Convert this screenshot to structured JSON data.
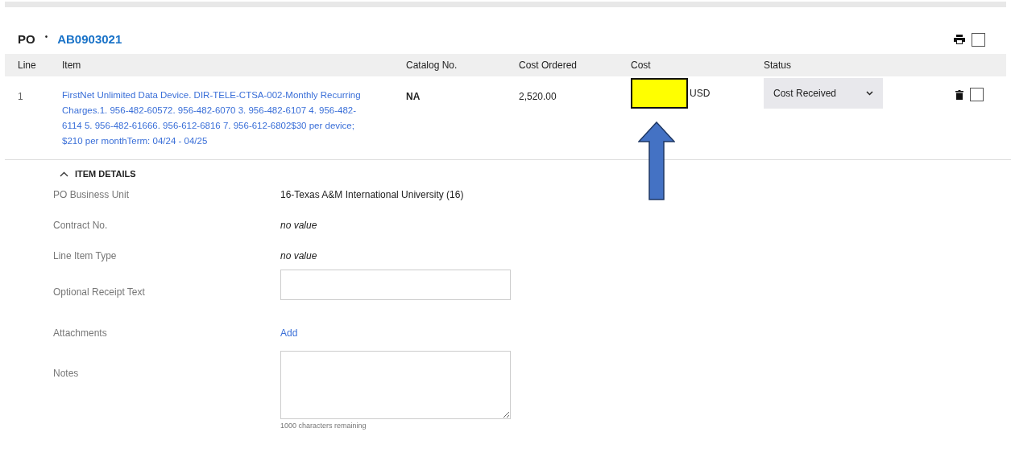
{
  "header": {
    "label": "PO",
    "separator": "•",
    "po_number": "AB0903021",
    "select_all_checked": false
  },
  "table": {
    "columns": [
      "Line",
      "Item",
      "Catalog No.",
      "Cost Ordered",
      "Cost",
      "Status"
    ],
    "rows": [
      {
        "line": "1",
        "item": "FirstNet Unlimited Data Device. DIR-TELE-CTSA-002-Monthly Recurring Charges.1. 956-482-60572. 956-482-6070 3. 956-482-6107 4. 956-482-6114 5. 956-482-61666. 956-612-6816 7. 956-612-6802$30 per device; $210 per monthTerm: 04/24 - 04/25",
        "catalog_no": "NA",
        "cost_ordered": "2,520.00",
        "cost": {
          "highlighted": true
        },
        "currency": "USD",
        "status": "Cost Received",
        "checked": false
      }
    ]
  },
  "item_details": {
    "title": "ITEM DETAILS",
    "expanded": true,
    "fields": [
      {
        "kind": "text",
        "label": "PO Business Unit",
        "value": "16-Texas A&M International University (16)"
      },
      {
        "kind": "empty",
        "label": "Contract No.",
        "value": "no value"
      },
      {
        "kind": "empty",
        "label": "Line Item Type",
        "value": "no value"
      },
      {
        "kind": "input",
        "label": "Optional Receipt Text"
      },
      {
        "kind": "link",
        "label": "Attachments",
        "value": "Add"
      },
      {
        "kind": "textarea",
        "label": "Notes",
        "hint": "1000 characters remaining"
      }
    ]
  }
}
